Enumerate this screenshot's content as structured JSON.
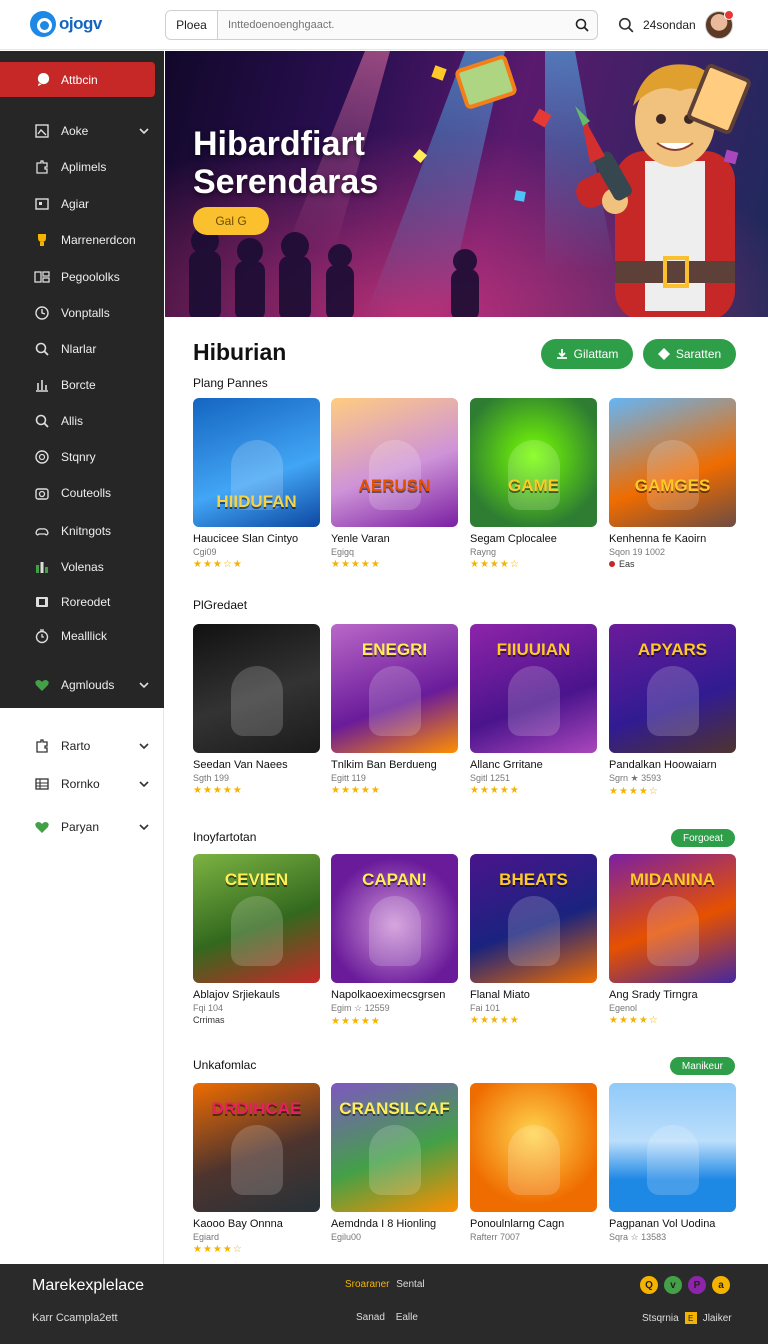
{
  "header": {
    "logo_text": "ojogv",
    "search_scope": "Ploea",
    "search_placeholder": "Inttedoenoenghgaact.",
    "user_name": "24sondan"
  },
  "sidebar": {
    "active_label": "Attbcin",
    "items": [
      {
        "label": "Aoke",
        "icon": "image-icon",
        "chevron": true
      },
      {
        "label": "Aplimels",
        "icon": "puzzle-icon",
        "chevron": false
      },
      {
        "label": "Agiar",
        "icon": "frame-icon",
        "chevron": false
      },
      {
        "label": "Marrenerdcon",
        "icon": "trophy-icon",
        "chevron": false
      },
      {
        "label": "Pegoololks",
        "icon": "grid-icon",
        "chevron": false
      },
      {
        "label": "Vonptalls",
        "icon": "clock-icon",
        "chevron": false
      },
      {
        "label": "Nlarlar",
        "icon": "search-icon",
        "chevron": false
      },
      {
        "label": "Borcte",
        "icon": "chart-icon",
        "chevron": false
      },
      {
        "label": "Allis",
        "icon": "search-icon",
        "chevron": false
      },
      {
        "label": "Stqnry",
        "icon": "circle-icon",
        "chevron": false
      },
      {
        "label": "Couteolls",
        "icon": "camera-icon",
        "chevron": false
      },
      {
        "label": "Knitngots",
        "icon": "gamepad-icon",
        "chevron": false
      },
      {
        "label": "Volenas",
        "icon": "bars-icon",
        "chevron": false
      },
      {
        "label": "Roreodet",
        "icon": "film-icon",
        "chevron": false
      },
      {
        "label": "Mealllick",
        "icon": "timer-icon",
        "chevron": false
      },
      {
        "label": "Agmlouds",
        "icon": "heart-icon",
        "chevron": true
      }
    ],
    "lower_items": [
      {
        "label": "Rarto",
        "icon": "puzzle-icon"
      },
      {
        "label": "Rornko",
        "icon": "table-icon"
      },
      {
        "label": "Paryan",
        "icon": "heart-icon"
      }
    ]
  },
  "hero": {
    "title_line1": "Hibardfiart",
    "title_line2": "Serendaras",
    "button_label": "Gal G"
  },
  "main": {
    "title": "Hiburian",
    "btn_primary": "Gilattam",
    "btn_secondary": "Saratten",
    "sections": [
      {
        "label": "Plang Pannes",
        "pill": "",
        "cards": [
          {
            "title": "Haucicee Slan Cintyo",
            "sub": "Cgi09",
            "rating": "★★★☆★",
            "tag": "",
            "art": "HIIDUFAN",
            "bg": "linear-gradient(160deg,#1565c0,#42a5f5 60%,#0d47a1)",
            "fg": "#f5d547"
          },
          {
            "title": "Yenle Varan",
            "sub": "Egigq",
            "rating": "★★★★★",
            "tag": "",
            "art": "AERUSN",
            "bg": "linear-gradient(160deg,#ffcc80,#ce93d8 55%,#7b1fa2)",
            "fg": "#e65100"
          },
          {
            "title": "Segam Cplocalee",
            "sub": "Rayng",
            "rating": "★★★★☆",
            "tag": "",
            "art": "GAME",
            "bg": "radial-gradient(circle at 50% 45%,#76ff03,#2e7d32 75%)",
            "fg": "#ffca28"
          },
          {
            "title": "Kenhenna fe Kaoirn",
            "sub": "Sqon 19 1002",
            "rating": "",
            "tag": "Eas",
            "art": "GAMGES",
            "bg": "linear-gradient(160deg,#64b5f6,#ef6c00 60%,#6d4c41)",
            "fg": "#ffca28"
          }
        ]
      },
      {
        "label": "PlGredaet",
        "pill": "",
        "cards": [
          {
            "title": "Seedan Van Naees",
            "sub": "Sgth 199",
            "rating": "★★★★★",
            "tag": "",
            "art": "",
            "bg": "linear-gradient(160deg,#111,#333 55%,#1b1b1b)",
            "fg": "#fff"
          },
          {
            "title": "Tnlkim Ban Berdueng",
            "sub": "Egitt 119",
            "rating": "★★★★★",
            "tag": "",
            "art": "ENEGRI",
            "bg": "linear-gradient(160deg,#ba68c8,#6a1b9a 60%,#ff8f00)",
            "fg": "#ffee58"
          },
          {
            "title": "Allanc Grritane",
            "sub": "Sgitl 1251",
            "rating": "★★★★★",
            "tag": "",
            "art": "FIIUUIAN",
            "bg": "linear-gradient(160deg,#8e24aa,#4a148c 60%,#ab47bc)",
            "fg": "#ffca28"
          },
          {
            "title": "Pandalkan Hoowaiarn",
            "sub": "Sgrn ★ 3593",
            "rating": "★★★★☆",
            "tag": "",
            "art": "APYARS",
            "bg": "linear-gradient(160deg,#6a1b9a,#311b92 60%,#4e342e)",
            "fg": "#ffca28"
          }
        ]
      },
      {
        "label": "Inoyfartotan",
        "pill": "Forgoeat",
        "cards": [
          {
            "title": "Ablajov Srjiekauls",
            "sub": "Fqi 104",
            "rating": "",
            "tag": "Crrimas",
            "art": "CEVIEN",
            "bg": "linear-gradient(160deg,#7cb342,#33691e 55%,#c62828)",
            "fg": "#ffee58"
          },
          {
            "title": "Napolkaoeximecsgrsen",
            "sub": "Egim ☆ 12559",
            "rating": "★★★★★",
            "tag": "",
            "art": "CAPAN!",
            "bg": "radial-gradient(circle at 50% 55%,#ce93d8,#6a1b9a 70%)",
            "fg": "#ffee58"
          },
          {
            "title": "Flanal Miato",
            "sub": "Fai 101",
            "rating": "★★★★★",
            "tag": "",
            "art": "BHEATS",
            "bg": "linear-gradient(160deg,#4a148c,#1a237e 55%,#ef6c00)",
            "fg": "#ffca28"
          },
          {
            "title": "Ang Srady Tirngra",
            "sub": "Egenol",
            "rating": "★★★★☆",
            "tag": "",
            "art": "MIDANINA",
            "bg": "linear-gradient(160deg,#7b1fa2,#e65100 55%,#4527a0)",
            "fg": "#ffca28"
          }
        ]
      },
      {
        "label": "Unkafomlac",
        "pill": "Manikeur",
        "cards": [
          {
            "title": "Kaooo Bay Onnna",
            "sub": "Egiard",
            "rating": "★★★★☆",
            "tag": "",
            "art": "DRDIHCAE",
            "bg": "linear-gradient(160deg,#ef6c00,#4e342e 55%,#263238)",
            "fg": "#e91e63"
          },
          {
            "title": "Aemdnda I 8 Hionling",
            "sub": "Egilu00",
            "rating": "",
            "tag": "",
            "art": "CRANSILCAF",
            "bg": "linear-gradient(160deg,#7e57c2,#43a047 55%,#ff8f00)",
            "fg": "#ffee58"
          },
          {
            "title": "Ponoulnlarng Cagn",
            "sub": "Rafterr 7007",
            "rating": "",
            "tag": "",
            "art": "",
            "bg": "radial-gradient(circle at 50% 40%,#ffd54f,#ef6c00 70%)",
            "fg": "#fff"
          },
          {
            "title": "Pagpanan Vol Uodina",
            "sub": "Sqra ☆ 13583",
            "rating": "",
            "tag": "",
            "art": "",
            "bg": "linear-gradient(180deg,#90caf9,#bbdefb 45%,#1e88e5 75%)",
            "fg": "#fff"
          }
        ]
      }
    ]
  },
  "footer": {
    "brand": "Marekexplelace",
    "copyright": "Karr Ccampla2ett",
    "mid1_accent": "Sroaraner",
    "mid1_text": "Sental",
    "mid2_a": "Sanad",
    "mid2_b": "Ealle",
    "right_a": "Stsqrnia",
    "right_badge": "E",
    "right_b": "Jlaiker",
    "social": [
      {
        "glyph": "Q",
        "color": "#f5b301"
      },
      {
        "glyph": "v",
        "color": "#43a047"
      },
      {
        "glyph": "P",
        "color": "#8e24aa"
      },
      {
        "glyph": "a",
        "color": "#f5b301"
      }
    ]
  }
}
